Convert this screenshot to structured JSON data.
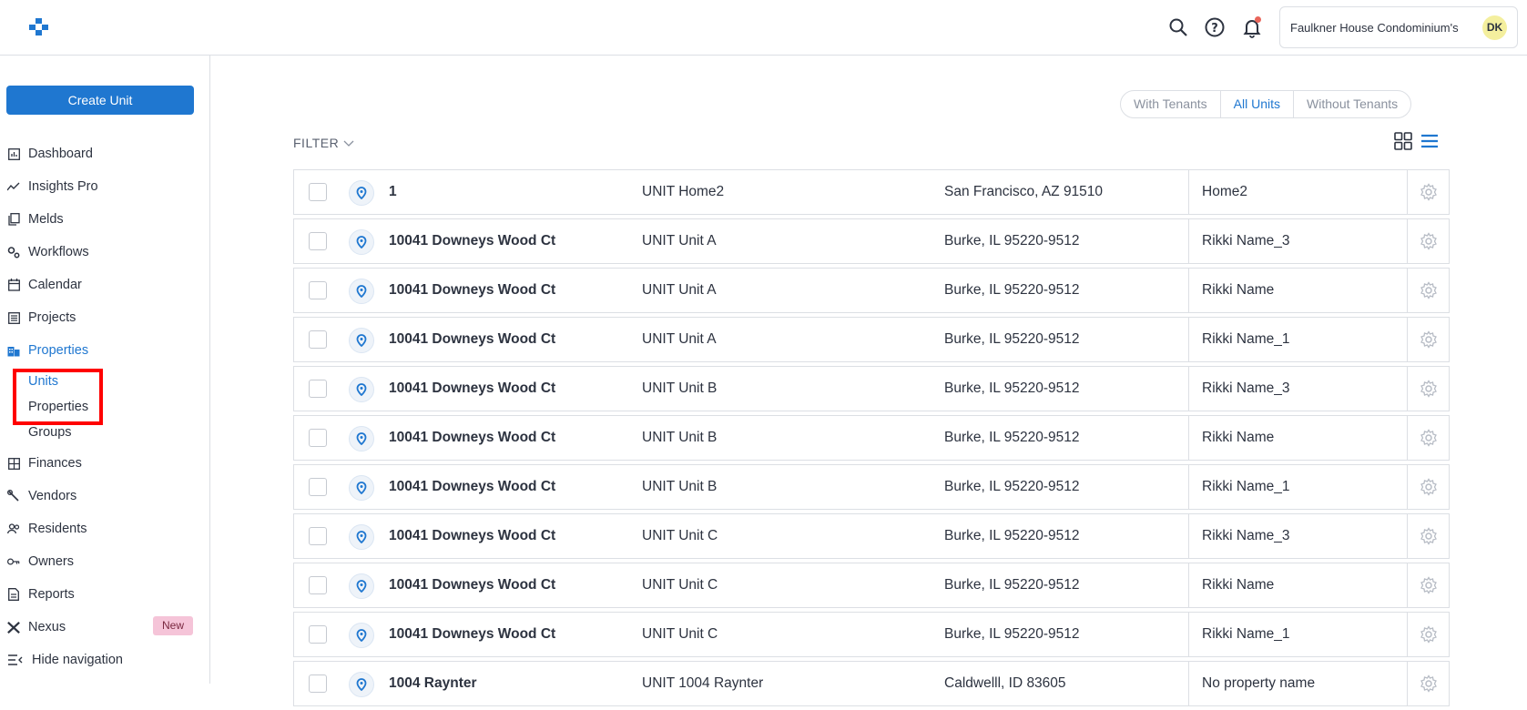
{
  "header": {
    "org_name": "Faulkner House Condominium's",
    "avatar_initials": "DK",
    "icons": [
      "search-icon",
      "help-icon",
      "bell-icon"
    ]
  },
  "sidebar": {
    "create_label": "Create Unit",
    "items": [
      {
        "label": "Dashboard",
        "icon": "dashboard-icon"
      },
      {
        "label": "Insights Pro",
        "icon": "insights-icon"
      },
      {
        "label": "Melds",
        "icon": "melds-icon"
      },
      {
        "label": "Workflows",
        "icon": "workflows-icon"
      },
      {
        "label": "Calendar",
        "icon": "calendar-icon"
      },
      {
        "label": "Projects",
        "icon": "projects-icon"
      },
      {
        "label": "Properties",
        "icon": "properties-icon"
      },
      {
        "label": "Finances",
        "icon": "finances-icon"
      },
      {
        "label": "Vendors",
        "icon": "vendors-icon"
      },
      {
        "label": "Residents",
        "icon": "residents-icon"
      },
      {
        "label": "Owners",
        "icon": "owners-icon"
      },
      {
        "label": "Reports",
        "icon": "reports-icon"
      },
      {
        "label": "Nexus",
        "icon": "nexus-icon"
      },
      {
        "label": "Hide navigation",
        "icon": "hide-nav-icon"
      }
    ],
    "sub_items": [
      "Units",
      "Properties",
      "Groups"
    ],
    "nexus_badge": "New"
  },
  "main": {
    "segments": [
      "With Tenants",
      "All Units",
      "Without Tenants"
    ],
    "active_segment": "All Units",
    "filter_label": "FILTER",
    "rows": [
      {
        "address": "1",
        "unit": "UNIT Home2",
        "city": "San Francisco, AZ 91510",
        "property": "Home2"
      },
      {
        "address": "10041 Downeys Wood Ct",
        "unit": "UNIT Unit A",
        "city": "Burke, IL 95220-9512",
        "property": "Rikki Name_3"
      },
      {
        "address": "10041 Downeys Wood Ct",
        "unit": "UNIT Unit A",
        "city": "Burke, IL 95220-9512",
        "property": "Rikki Name"
      },
      {
        "address": "10041 Downeys Wood Ct",
        "unit": "UNIT Unit A",
        "city": "Burke, IL 95220-9512",
        "property": "Rikki Name_1"
      },
      {
        "address": "10041 Downeys Wood Ct",
        "unit": "UNIT Unit B",
        "city": "Burke, IL 95220-9512",
        "property": "Rikki Name_3"
      },
      {
        "address": "10041 Downeys Wood Ct",
        "unit": "UNIT Unit B",
        "city": "Burke, IL 95220-9512",
        "property": "Rikki Name"
      },
      {
        "address": "10041 Downeys Wood Ct",
        "unit": "UNIT Unit B",
        "city": "Burke, IL 95220-9512",
        "property": "Rikki Name_1"
      },
      {
        "address": "10041 Downeys Wood Ct",
        "unit": "UNIT Unit C",
        "city": "Burke, IL 95220-9512",
        "property": "Rikki Name_3"
      },
      {
        "address": "10041 Downeys Wood Ct",
        "unit": "UNIT Unit C",
        "city": "Burke, IL 95220-9512",
        "property": "Rikki Name"
      },
      {
        "address": "10041 Downeys Wood Ct",
        "unit": "UNIT Unit C",
        "city": "Burke, IL 95220-9512",
        "property": "Rikki Name_1"
      },
      {
        "address": "1004 Raynter",
        "unit": "UNIT 1004 Raynter",
        "city": "Caldwelll, ID 83605",
        "property": "No property name"
      }
    ]
  },
  "colors": {
    "accent": "#1f77d0",
    "highlight": "#ff0000",
    "badge": "#f5c4d8"
  }
}
